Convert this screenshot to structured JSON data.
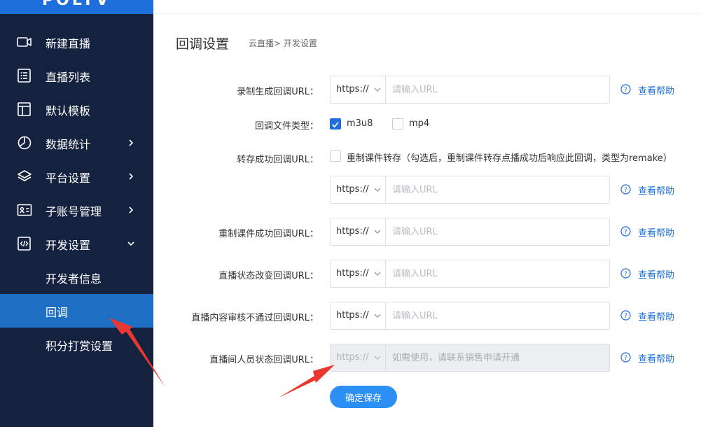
{
  "brand": {
    "logo_text": "POLYV"
  },
  "sidebar": {
    "items": [
      {
        "label": "新建直播",
        "icon": "video-camera-icon",
        "has_chevron": false
      },
      {
        "label": "直播列表",
        "icon": "list-icon",
        "has_chevron": false
      },
      {
        "label": "默认模板",
        "icon": "layout-template-icon",
        "has_chevron": false
      },
      {
        "label": "数据统计",
        "icon": "pie-chart-icon",
        "has_chevron": true
      },
      {
        "label": "平台设置",
        "icon": "layers-icon",
        "has_chevron": true
      },
      {
        "label": "子账号管理",
        "icon": "id-card-icon",
        "has_chevron": true
      },
      {
        "label": "开发设置",
        "icon": "code-icon",
        "has_chevron": true,
        "expanded": true
      }
    ],
    "sub_items": [
      {
        "label": "开发者信息",
        "active": false
      },
      {
        "label": "回调",
        "active": true
      },
      {
        "label": "积分打赏设置",
        "active": false
      }
    ]
  },
  "header": {
    "title": "回调设置",
    "breadcrumb": [
      "云直播",
      "开发设置"
    ],
    "breadcrumb_sep": ">"
  },
  "form": {
    "protocol_option": "https://",
    "url_placeholder": "请输入URL",
    "help_label": "查看帮助",
    "fields": {
      "record": {
        "label": "录制生成回调URL："
      },
      "file_type": {
        "label": "回调文件类型：",
        "options": [
          {
            "label": "m3u8",
            "checked": true
          },
          {
            "label": "mp4",
            "checked": false
          }
        ]
      },
      "transcode": {
        "label": "转存成功回调URL：",
        "checkbox_label": "重制课件转存（勾选后，重制课件转存点播成功后响应此回调，类型为remake）",
        "checked": false
      },
      "remake": {
        "label": "重制课件成功回调URL："
      },
      "status": {
        "label": "直播状态改变回调URL："
      },
      "audit": {
        "label": "直播内容审核不通过回调URL："
      },
      "members": {
        "label": "直播间人员状态回调URL：",
        "disabled_placeholder": "如需使用，请联系销售申请开通",
        "disabled": true
      }
    },
    "save_label": "确定保存"
  },
  "colors": {
    "sidebar_bg": "#14213f",
    "active_bg": "#1e6fc3",
    "brand_blue": "#1e6fd9",
    "button_blue": "#2b8ff5",
    "annotation_red": "#e8382f"
  }
}
